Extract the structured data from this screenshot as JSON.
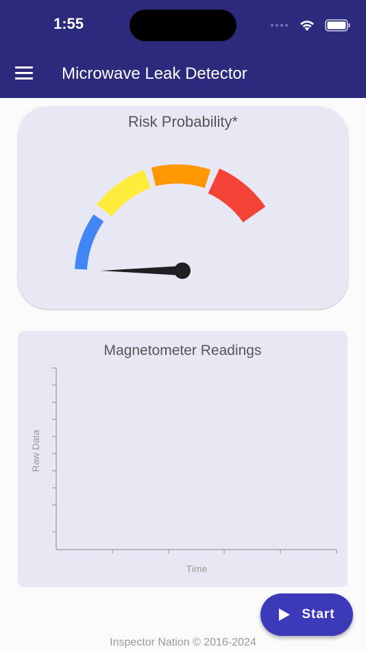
{
  "status_bar": {
    "time": "1:55"
  },
  "app_bar": {
    "title": "Microwave Leak Detector",
    "menu_icon": "hamburger-menu-icon"
  },
  "risk_card": {
    "title": "Risk Probability*",
    "gauge_segment_colors": [
      "#4285f4",
      "#ffeb3b",
      "#ff9800",
      "#f44336"
    ],
    "needle_color": "#1f1f24"
  },
  "magnetometer_card": {
    "title": "Magnetometer Readings",
    "y_label": "Raw Data",
    "x_label": "Time"
  },
  "fab": {
    "label": "Start",
    "icon": "play-icon"
  },
  "footer": {
    "text": "Inspector Nation © 2016-2024"
  },
  "colors": {
    "app_bar": "#2c2a7c",
    "card_background": "#e8e8f4",
    "fab": "#3c3ab8"
  }
}
